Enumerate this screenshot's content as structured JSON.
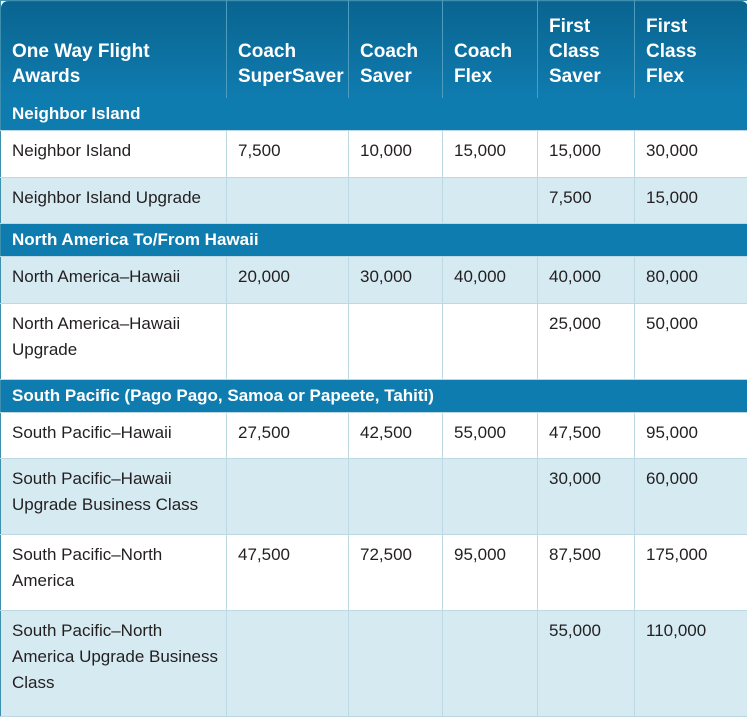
{
  "table": {
    "columns": [
      "One Way Flight\nAwards",
      "Coach\nSuperSaver",
      "Coach\nSaver",
      "Coach\nFlex",
      "First\nClass\nSaver",
      "First\nClass\nFlex"
    ],
    "sections": [
      {
        "title": "Neighbor Island",
        "rows": [
          {
            "shaded": false,
            "cells": [
              "Neighbor Island",
              "7,500",
              "10,000",
              "15,000",
              "15,000",
              "30,000"
            ]
          },
          {
            "shaded": true,
            "cells": [
              "Neighbor Island Upgrade",
              "",
              "",
              "",
              "7,500",
              "15,000"
            ]
          }
        ]
      },
      {
        "title": "North America To/From Hawaii",
        "rows": [
          {
            "shaded": true,
            "cells": [
              "North America–Hawaii",
              "20,000",
              "30,000",
              "40,000",
              "40,000",
              "80,000"
            ]
          },
          {
            "shaded": false,
            "cells": [
              "North America–Hawaii Upgrade",
              "",
              "",
              "",
              "25,000",
              "50,000"
            ]
          }
        ]
      },
      {
        "title": "South Pacific (Pago Pago, Samoa or Papeete, Tahiti)",
        "rows": [
          {
            "shaded": false,
            "cells": [
              "South Pacific–Hawaii",
              "27,500",
              "42,500",
              "55,000",
              "47,500",
              "95,000"
            ]
          },
          {
            "shaded": true,
            "cells": [
              "South Pacific–Hawaii Upgrade Business Class",
              "",
              "",
              "",
              "30,000",
              "60,000"
            ]
          },
          {
            "shaded": false,
            "cells": [
              "South Pacific–North America",
              "47,500",
              "72,500",
              "95,000",
              "87,500",
              "175,000"
            ]
          },
          {
            "shaded": true,
            "cells": [
              "South Pacific–North America Upgrade Business Class",
              "",
              "",
              "",
              "55,000",
              "110,000"
            ]
          }
        ]
      }
    ],
    "colors": {
      "header_top": "#0a6490",
      "header_bottom": "#0f7cb0",
      "section_band": "#0f7cb0",
      "row_shade": "#d6eaf2",
      "row_plain": "#ffffff",
      "grid_line": "#bcd9e4",
      "table_border": "#3d8fae",
      "header_text": "#ffffff",
      "body_text": "#231f20"
    }
  }
}
